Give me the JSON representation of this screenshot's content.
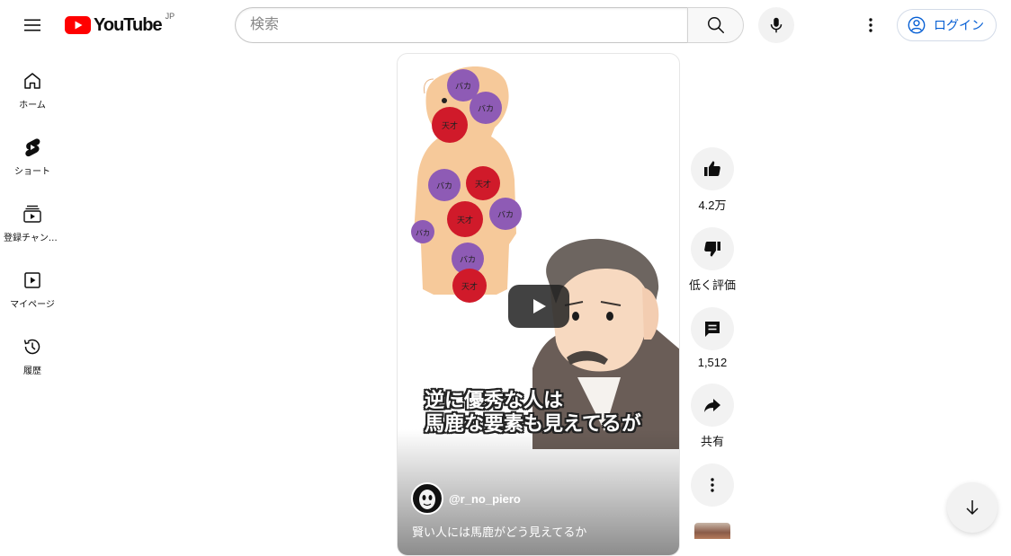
{
  "header": {
    "logo_text": "YouTube",
    "logo_country": "JP",
    "search_placeholder": "検索",
    "login_label": "ログイン"
  },
  "sidebar": {
    "items": [
      {
        "label": "ホーム",
        "icon": "home-icon"
      },
      {
        "label": "ショート",
        "icon": "shorts-icon"
      },
      {
        "label": "登録チャンネル",
        "icon": "subscriptions-icon"
      },
      {
        "label": "マイページ",
        "icon": "library-icon"
      },
      {
        "label": "履歴",
        "icon": "history-icon"
      }
    ]
  },
  "video": {
    "caption_line1": "逆に優秀な人は",
    "caption_line2": "馬鹿な要素も見えてるが",
    "channel": "@r_no_piero",
    "title": "賢い人には馬鹿がどう見えてるか",
    "ball_labels": {
      "baka": "バカ",
      "tensai": "天才"
    }
  },
  "actions": {
    "likes": "4.2万",
    "dislike": "低く評価",
    "comments": "1,512",
    "share": "共有"
  },
  "colors": {
    "brand_red": "#ff0000",
    "link_blue": "#065fd4",
    "baka_ball": "#8e5bb5",
    "tensai_ball": "#d01a2a"
  }
}
